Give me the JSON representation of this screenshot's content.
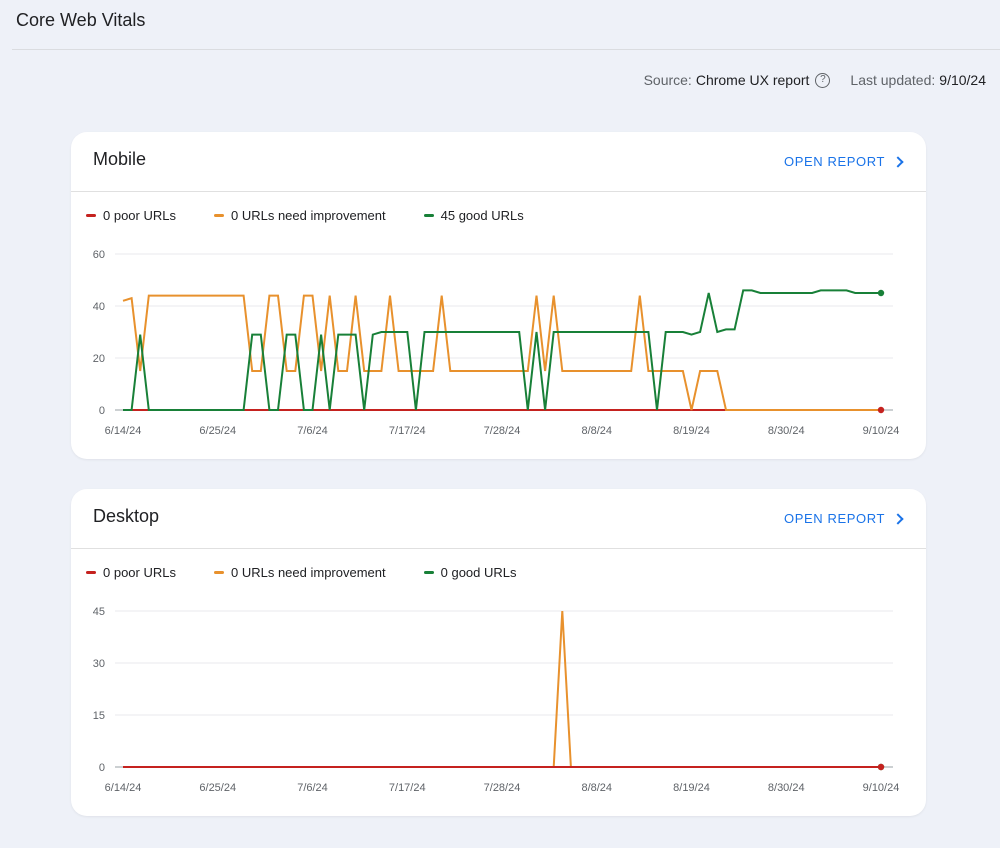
{
  "page": {
    "title": "Core Web Vitals",
    "source_label": "Source:",
    "source_value": "Chrome UX report",
    "help_icon": "help-circle-icon",
    "last_updated_label": "Last updated:",
    "last_updated_value": "9/10/24"
  },
  "colors": {
    "poor": "#c5221f",
    "needs_improvement": "#e8912d",
    "good": "#188038",
    "link": "#1a73e8"
  },
  "cards": [
    {
      "title": "Mobile",
      "action_label": "OPEN REPORT",
      "legend": [
        "0 poor URLs",
        "0 URLs need improvement",
        "45 good URLs"
      ]
    },
    {
      "title": "Desktop",
      "action_label": "OPEN REPORT",
      "legend": [
        "0 poor URLs",
        "0 URLs need improvement",
        "0 good URLs"
      ]
    }
  ],
  "chart_data": [
    {
      "type": "line",
      "x_ticks": [
        "6/14/24",
        "6/25/24",
        "7/6/24",
        "7/17/24",
        "7/28/24",
        "8/8/24",
        "8/19/24",
        "8/30/24",
        "9/10/24"
      ],
      "y_ticks": [
        0,
        20,
        40,
        60
      ],
      "ylim": [
        0,
        60
      ],
      "x_domain_days": [
        0,
        88
      ],
      "grid": true,
      "legend_position": "top-left",
      "series": [
        {
          "key": "poor",
          "color": "#c5221f",
          "points": [
            [
              0,
              0
            ],
            [
              88,
              0
            ]
          ]
        },
        {
          "key": "needs_improvement",
          "color": "#e8912d",
          "points": [
            [
              0,
              42
            ],
            [
              1,
              43
            ],
            [
              2,
              15
            ],
            [
              3,
              44
            ],
            [
              14,
              44
            ],
            [
              15,
              15
            ],
            [
              16,
              15
            ],
            [
              17,
              44
            ],
            [
              18,
              44
            ],
            [
              19,
              15
            ],
            [
              20,
              15
            ],
            [
              21,
              44
            ],
            [
              22,
              44
            ],
            [
              23,
              15
            ],
            [
              24,
              44
            ],
            [
              25,
              15
            ],
            [
              26,
              15
            ],
            [
              27,
              44
            ],
            [
              28,
              15
            ],
            [
              29,
              15
            ],
            [
              30,
              15
            ],
            [
              31,
              44
            ],
            [
              32,
              15
            ],
            [
              33,
              15
            ],
            [
              34,
              15
            ],
            [
              35,
              15
            ],
            [
              36,
              15
            ],
            [
              37,
              44
            ],
            [
              38,
              15
            ],
            [
              39,
              15
            ],
            [
              40,
              15
            ],
            [
              41,
              15
            ],
            [
              42,
              15
            ],
            [
              43,
              15
            ],
            [
              44,
              15
            ],
            [
              45,
              15
            ],
            [
              46,
              15
            ],
            [
              47,
              15
            ],
            [
              48,
              44
            ],
            [
              49,
              15
            ],
            [
              50,
              44
            ],
            [
              51,
              15
            ],
            [
              52,
              15
            ],
            [
              53,
              15
            ],
            [
              54,
              15
            ],
            [
              55,
              15
            ],
            [
              56,
              15
            ],
            [
              57,
              15
            ],
            [
              58,
              15
            ],
            [
              59,
              15
            ],
            [
              60,
              44
            ],
            [
              61,
              15
            ],
            [
              62,
              15
            ],
            [
              63,
              15
            ],
            [
              64,
              15
            ],
            [
              65,
              15
            ],
            [
              66,
              0
            ],
            [
              67,
              15
            ],
            [
              68,
              15
            ],
            [
              69,
              15
            ],
            [
              70,
              0
            ],
            [
              88,
              0
            ]
          ]
        },
        {
          "key": "good",
          "color": "#188038",
          "points": [
            [
              0,
              0
            ],
            [
              1,
              0
            ],
            [
              2,
              29
            ],
            [
              3,
              0
            ],
            [
              14,
              0
            ],
            [
              15,
              29
            ],
            [
              16,
              29
            ],
            [
              17,
              0
            ],
            [
              18,
              0
            ],
            [
              19,
              29
            ],
            [
              20,
              29
            ],
            [
              21,
              0
            ],
            [
              22,
              0
            ],
            [
              23,
              29
            ],
            [
              24,
              0
            ],
            [
              25,
              29
            ],
            [
              26,
              29
            ],
            [
              27,
              29
            ],
            [
              28,
              0
            ],
            [
              29,
              29
            ],
            [
              30,
              30
            ],
            [
              31,
              30
            ],
            [
              32,
              30
            ],
            [
              33,
              30
            ],
            [
              34,
              0
            ],
            [
              35,
              30
            ],
            [
              36,
              30
            ],
            [
              37,
              30
            ],
            [
              38,
              30
            ],
            [
              39,
              30
            ],
            [
              40,
              30
            ],
            [
              41,
              30
            ],
            [
              42,
              30
            ],
            [
              43,
              30
            ],
            [
              44,
              30
            ],
            [
              45,
              30
            ],
            [
              46,
              30
            ],
            [
              47,
              0
            ],
            [
              48,
              30
            ],
            [
              49,
              0
            ],
            [
              50,
              30
            ],
            [
              51,
              30
            ],
            [
              52,
              30
            ],
            [
              53,
              30
            ],
            [
              54,
              30
            ],
            [
              55,
              30
            ],
            [
              56,
              30
            ],
            [
              57,
              30
            ],
            [
              58,
              30
            ],
            [
              59,
              30
            ],
            [
              60,
              30
            ],
            [
              61,
              30
            ],
            [
              62,
              0
            ],
            [
              63,
              30
            ],
            [
              64,
              30
            ],
            [
              65,
              30
            ],
            [
              66,
              29
            ],
            [
              67,
              30
            ],
            [
              68,
              45
            ],
            [
              69,
              30
            ],
            [
              70,
              31
            ],
            [
              71,
              31
            ],
            [
              72,
              46
            ],
            [
              73,
              46
            ],
            [
              74,
              45
            ],
            [
              75,
              45
            ],
            [
              76,
              45
            ],
            [
              77,
              45
            ],
            [
              78,
              45
            ],
            [
              79,
              45
            ],
            [
              80,
              45
            ],
            [
              81,
              46
            ],
            [
              82,
              46
            ],
            [
              83,
              46
            ],
            [
              84,
              46
            ],
            [
              85,
              45
            ],
            [
              86,
              45
            ],
            [
              87,
              45
            ],
            [
              88,
              45
            ]
          ]
        }
      ]
    },
    {
      "type": "line",
      "x_ticks": [
        "6/14/24",
        "6/25/24",
        "7/6/24",
        "7/17/24",
        "7/28/24",
        "8/8/24",
        "8/19/24",
        "8/30/24",
        "9/10/24"
      ],
      "y_ticks": [
        0,
        15,
        30,
        45
      ],
      "ylim": [
        0,
        45
      ],
      "x_domain_days": [
        0,
        88
      ],
      "grid": true,
      "legend_position": "top-left",
      "series": [
        {
          "key": "needs_improvement",
          "color": "#e8912d",
          "points": [
            [
              0,
              0
            ],
            [
              50,
              0
            ],
            [
              51,
              45
            ],
            [
              52,
              0
            ],
            [
              88,
              0
            ]
          ]
        },
        {
          "key": "good",
          "color": "#188038",
          "points": [
            [
              0,
              0
            ],
            [
              88,
              0
            ]
          ]
        },
        {
          "key": "poor",
          "color": "#c5221f",
          "points": [
            [
              0,
              0
            ],
            [
              88,
              0
            ]
          ]
        }
      ]
    }
  ]
}
